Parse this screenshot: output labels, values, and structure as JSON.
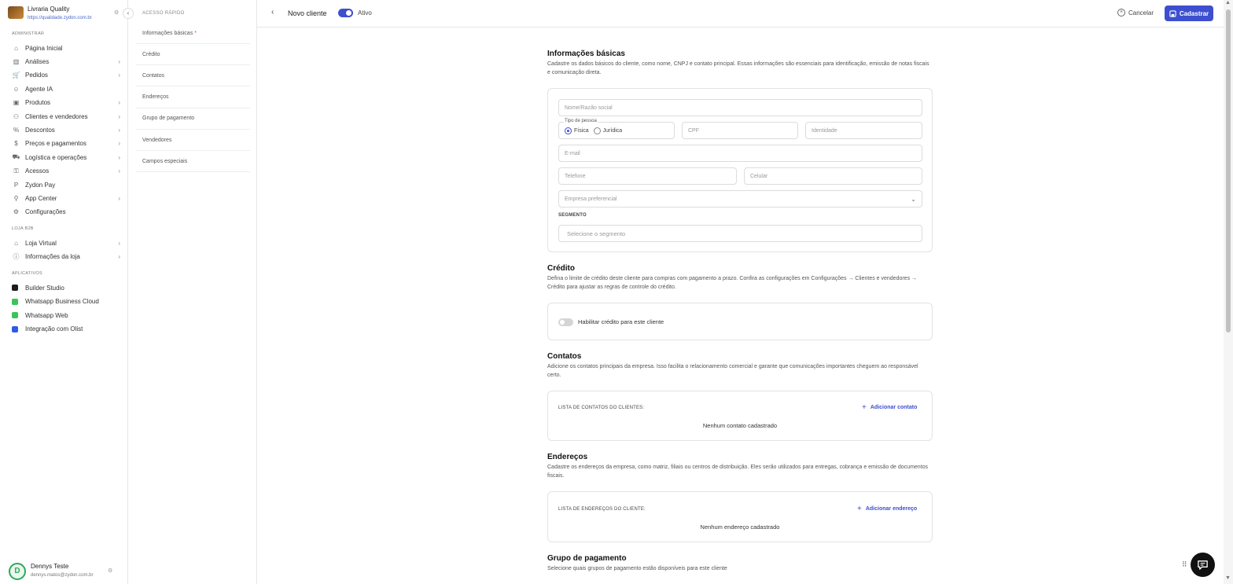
{
  "store": {
    "name": "Livraria Quality",
    "url": "https://qualidade.zydon.com.br"
  },
  "sidebar": {
    "sections": {
      "admin": "ADMINISTRAR",
      "b2b": "LOJA B2B",
      "apps": "APLICATIVOS"
    },
    "admin_items": [
      {
        "label": "Página Inicial",
        "icon": "home-icon",
        "chevron": false
      },
      {
        "label": "Análises",
        "icon": "chart-icon",
        "chevron": true
      },
      {
        "label": "Pedidos",
        "icon": "cart-icon",
        "chevron": true
      },
      {
        "label": "Agente IA",
        "icon": "robot-icon",
        "chevron": false
      },
      {
        "label": "Produtos",
        "icon": "box-icon",
        "chevron": true
      },
      {
        "label": "Clientes e vendedores",
        "icon": "users-icon",
        "chevron": true
      },
      {
        "label": "Descontos",
        "icon": "discount-icon",
        "chevron": true
      },
      {
        "label": "Preços e pagamentos",
        "icon": "dollar-icon",
        "chevron": true
      },
      {
        "label": "Logística e operações",
        "icon": "truck-icon",
        "chevron": true
      },
      {
        "label": "Acessos",
        "icon": "key-icon",
        "chevron": true
      },
      {
        "label": "Zydon Pay",
        "icon": "pay-icon",
        "chevron": false
      },
      {
        "label": "App Center",
        "icon": "apps-icon",
        "chevron": true
      },
      {
        "label": "Configurações",
        "icon": "gear-icon",
        "chevron": false
      }
    ],
    "b2b_items": [
      {
        "label": "Loja Virtual",
        "icon": "store-icon",
        "chevron": true
      },
      {
        "label": "Informações da loja",
        "icon": "info-icon",
        "chevron": true
      }
    ],
    "app_items": [
      {
        "label": "Builder Studio",
        "color": "#1d1d1d"
      },
      {
        "label": "Whatsapp Business Cloud",
        "color": "#3cc45a"
      },
      {
        "label": "Whatsapp Web",
        "color": "#3cc45a"
      },
      {
        "label": "Integração com Olist",
        "color": "#2d5be3"
      }
    ]
  },
  "user": {
    "initial": "D",
    "name": "Dennys Teste",
    "email": "dennys.matos@zydon.com.br"
  },
  "quick_access": {
    "title": "ACESSO RÁPIDO",
    "items": [
      "Informações básicas",
      "Crédito",
      "Contatos",
      "Endereços",
      "Grupo de pagamento",
      "Vendedores",
      "Campos especiais"
    ],
    "required_mark": "*"
  },
  "topbar": {
    "title": "Novo cliente",
    "status_label": "Ativo",
    "status_on": true,
    "cancel_label": "Cancelar",
    "save_label": "Cadastrar"
  },
  "basic_info": {
    "title": "Informações básicas",
    "description": "Cadastre os dados básicos do cliente, como nome, CNPJ e contato principal. Essas informações são essenciais para identificação, emissão de notas fiscais e comunicação direta.",
    "name_placeholder": "Nome/Razão social",
    "person_type_label": "Tipo de pessoa",
    "person_type_options": [
      "Física",
      "Jurídica"
    ],
    "person_type_selected": "Física",
    "cpf_placeholder": "CPF",
    "id_placeholder": "Identidade",
    "email_placeholder": "E-mail",
    "phone_placeholder": "Telefone",
    "mobile_placeholder": "Celular",
    "company_placeholder": "Empresa preferencial",
    "segment_label": "SEGMENTO",
    "segment_placeholder": "Selecione o segmento"
  },
  "credit": {
    "title": "Crédito",
    "description": "Defina o limite de crédito deste cliente para compras com pagamento a prazo. Confira as configurações em Configurações → Clientes e vendedores → Crédito para ajustar as regras de controle do crédito.",
    "toggle_label": "Habilitar crédito para este cliente",
    "toggle_on": false
  },
  "contacts": {
    "title": "Contatos",
    "description": "Adicione os contatos principais da empresa. Isso facilita o relacionamento comercial e garante que comunicações importantes cheguem ao responsável certo.",
    "list_label": "LISTA DE CONTATOS DO CLIENTES:",
    "add_label": "Adicionar contato",
    "empty_label": "Nenhum contato cadastrado"
  },
  "addresses": {
    "title": "Endereços",
    "description": "Cadastre os endereços da empresa, como matriz, filiais ou centros de distribuição. Eles serão utilizados para entregas, cobrança e emissão de documentos fiscais.",
    "list_label": "LISTA DE ENDEREÇOS DO CLIENTE:",
    "add_label": "Adicionar endereço",
    "empty_label": "Nenhum endereço cadastrado"
  },
  "payment_group": {
    "title": "Grupo de pagamento",
    "description": "Selecione quais grupos de pagamento estão disponíveis para este cliente"
  },
  "colors": {
    "accent": "#3d4fcf",
    "required": "#e0474c"
  }
}
